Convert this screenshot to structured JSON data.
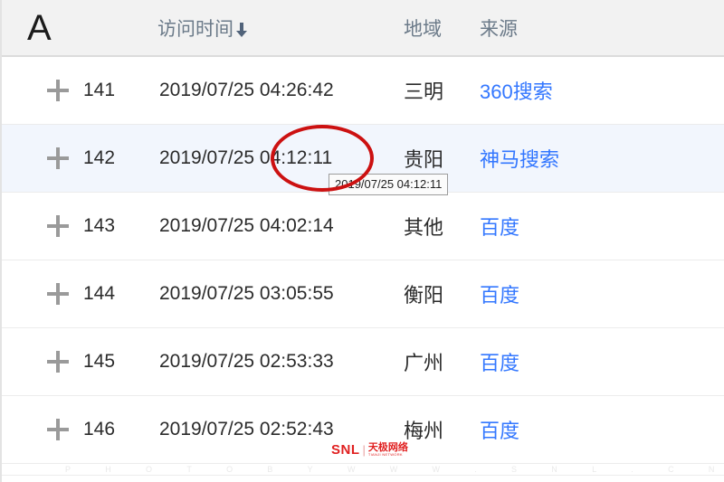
{
  "table": {
    "headers": {
      "col_a": "A",
      "col_time": "访问时间",
      "sort_icon": "arrow-down-icon",
      "col_region": "地域",
      "col_source": "来源"
    },
    "expand_icon": "plus-icon",
    "rows": [
      {
        "id": "141",
        "time": "2019/07/25 04:26:42",
        "region": "三明",
        "source": "360搜索",
        "highlighted": false
      },
      {
        "id": "142",
        "time": "2019/07/25 04:12:11",
        "region": "贵阳",
        "source": "神马搜索",
        "highlighted": true
      },
      {
        "id": "143",
        "time": "2019/07/25 04:02:14",
        "region": "其他",
        "source": "百度",
        "highlighted": false
      },
      {
        "id": "144",
        "time": "2019/07/25 03:05:55",
        "region": "衡阳",
        "source": "百度",
        "highlighted": false
      },
      {
        "id": "145",
        "time": "2019/07/25 02:53:33",
        "region": "广州",
        "source": "百度",
        "highlighted": false
      },
      {
        "id": "146",
        "time": "2019/07/25 02:52:43",
        "region": "梅州",
        "source": "百度",
        "highlighted": false
      }
    ]
  },
  "annotation": {
    "circle_color": "#cc1111",
    "target_text": "04:12:11"
  },
  "tooltip": {
    "text": "2019/07/25 04:12:11"
  },
  "watermark": {
    "logo_text": "SNL",
    "logo_divider": "|",
    "logo_cn": "天极网络",
    "logo_cn_sub": "TIANJI NETWORK",
    "bottom_letters": [
      "P",
      "H",
      "O",
      "T",
      "O",
      "B",
      "Y",
      "W",
      "W",
      "W",
      ".",
      "S",
      "N",
      "L",
      ".",
      "C",
      "N"
    ]
  },
  "colors": {
    "link": "#3377ff",
    "header_bg": "#f2f2f2",
    "row_highlight": "#f2f6fd",
    "annotation_red": "#cc1111"
  }
}
